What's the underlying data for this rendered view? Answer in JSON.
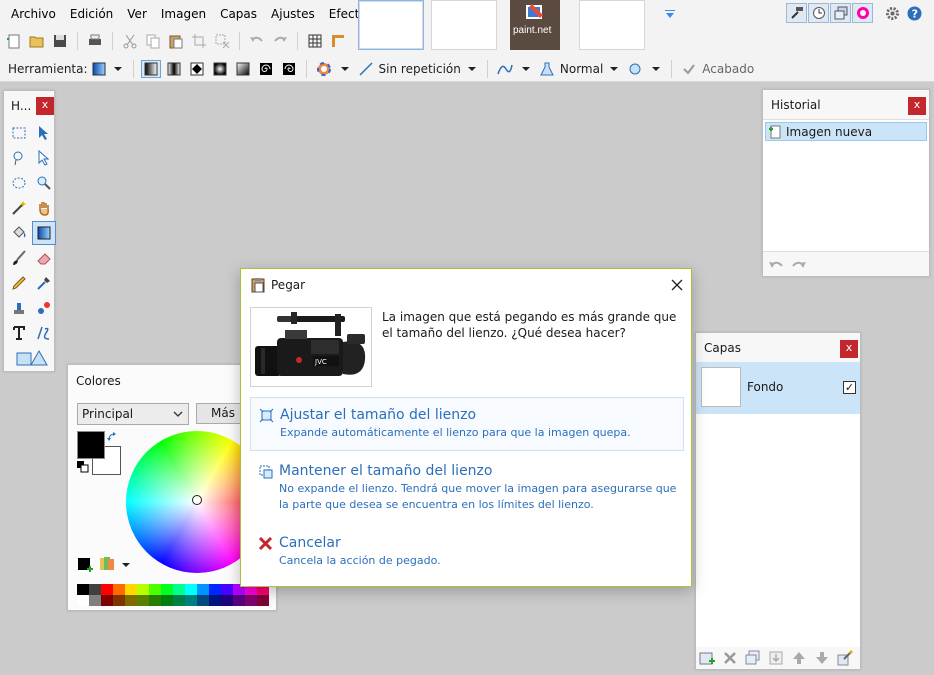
{
  "menu": {
    "archivo": "Archivo",
    "edicion": "Edición",
    "ver": "Ver",
    "imagen": "Imagen",
    "capas": "Capas",
    "ajustes": "Ajustes",
    "efectos": "Efectos"
  },
  "image_tabs": {
    "logo_label": "paint.net"
  },
  "toolbar2": {
    "herramienta_label": "Herramienta:",
    "sampling_label": "Sin repetición",
    "blend_label": "Normal",
    "finish_label": "Acabado"
  },
  "tools_panel": {
    "title": "H...",
    "close": "x"
  },
  "history_panel": {
    "title": "Historial",
    "close": "x",
    "items": [
      "Imagen nueva"
    ]
  },
  "colors_panel": {
    "title": "Colores",
    "palette_select": "Principal",
    "more_button": "Más >>",
    "primary_color": "#000000",
    "secondary_color": "#ffffff",
    "palette_top": [
      "#000000",
      "#404040",
      "#ff0000",
      "#ff6a00",
      "#ffd800",
      "#b6ff00",
      "#4cff00",
      "#00ff21",
      "#00ff90",
      "#00ffff",
      "#0094ff",
      "#0026ff",
      "#4800ff",
      "#b200ff",
      "#ff00dc",
      "#ff006e"
    ],
    "palette_bottom": [
      "#ffffff",
      "#808080",
      "#7f0000",
      "#7f3300",
      "#7f6a00",
      "#5b7f00",
      "#267f00",
      "#007f0e",
      "#007f46",
      "#007f7f",
      "#004a7f",
      "#00137f",
      "#21007f",
      "#57007f",
      "#7f006e",
      "#7f0037"
    ]
  },
  "layers_panel": {
    "title": "Capas",
    "close": "x",
    "layer_name": "Fondo",
    "layer_visible": "✓"
  },
  "paste_dialog": {
    "title": "Pegar",
    "message": "La imagen que está pegando es más grande que el tamaño del lienzo. ¿Qué desea hacer?",
    "options": [
      {
        "title": "Ajustar el tamaño del lienzo",
        "desc": "Expande automáticamente el lienzo para que la imagen quepa."
      },
      {
        "title": "Mantener el tamaño del lienzo",
        "desc": "No expande el lienzo. Tendrá que mover la imagen para asegurarse que la parte que desea se encuentra en los límites del lienzo."
      },
      {
        "title": "Cancelar",
        "desc": "Cancela la acción de pegado."
      }
    ],
    "camera_brand": "JVC"
  },
  "colors": {
    "accent_green": "#a4c639",
    "link_blue": "#2b6fba",
    "close_red": "#c4262e",
    "selection_blue": "#cce4f7"
  }
}
